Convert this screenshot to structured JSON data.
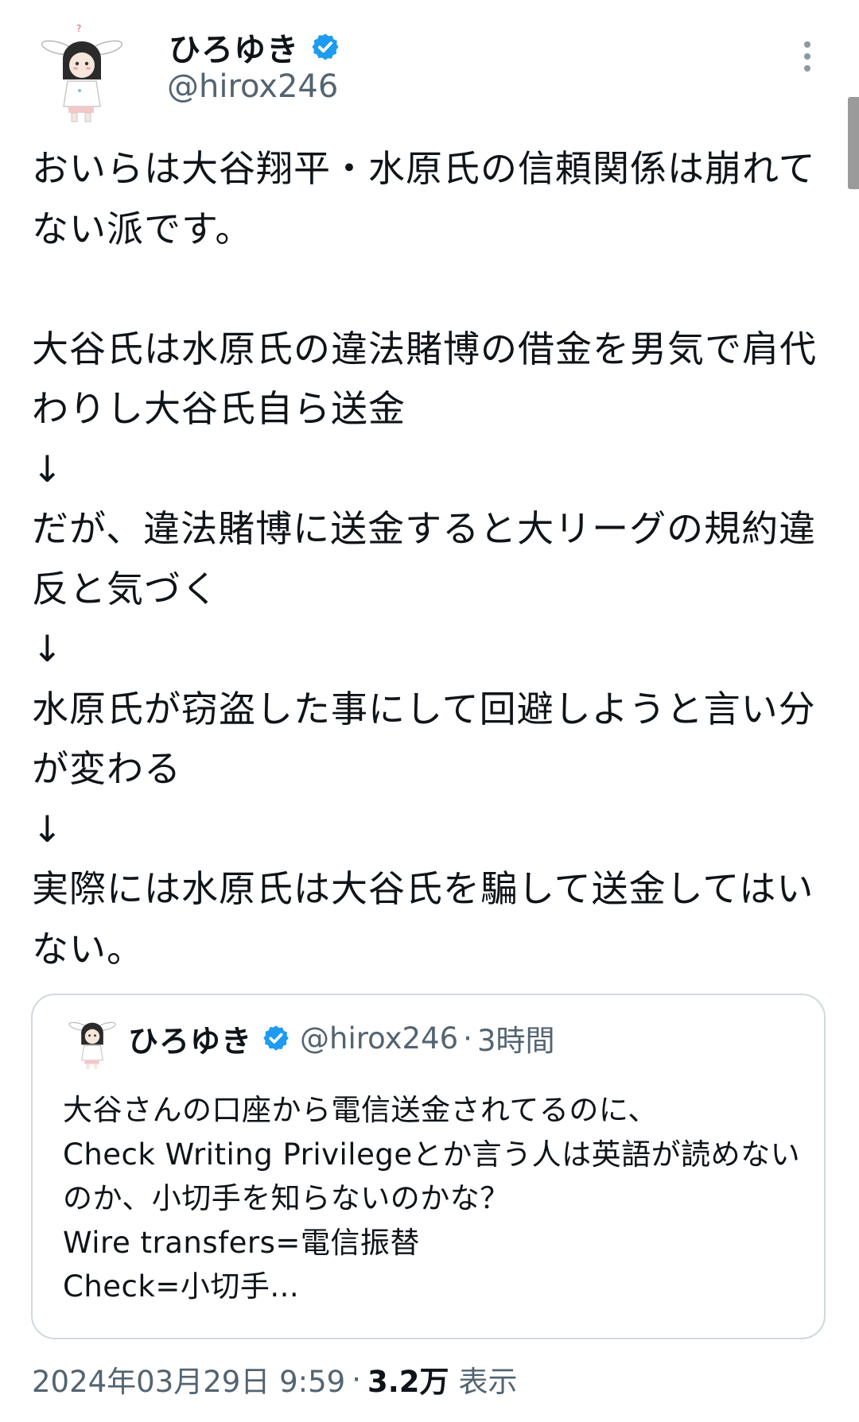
{
  "author": {
    "display_name": "ひろゆき",
    "handle": "@hirox246",
    "verified": true,
    "verified_color": "#1d9bf0"
  },
  "tweet": {
    "text": "おいらは大谷翔平・水原氏の信頼関係は崩れてない派です。\n\n大谷氏は水原氏の違法賭博の借金を男気で肩代わりし大谷氏自ら送金\n↓\nだが、違法賭博に送金すると大リーグの規約違反と気づく\n↓\n水原氏が窃盗した事にして回避しようと言い分が変わる\n↓\n実際には水原氏は大谷氏を騙して送金してはいない。"
  },
  "quote": {
    "display_name": "ひろゆき",
    "handle": "@hirox246",
    "separator": "·",
    "time": "3時間",
    "text": "大谷さんの口座から電信送金されてるのに、\nCheck Writing Privilegeとか言う人は英語が読めないのか、小切手を知らないのかな？\nWire transfers=電信振替\nCheck=小切手..."
  },
  "meta": {
    "timestamp": "2024年03月29日 9:59",
    "separator": "·",
    "views_count": "3.2万",
    "views_label": "表示"
  },
  "icons": {
    "more": "more-vertical-icon",
    "verified": "verified-badge-icon"
  }
}
